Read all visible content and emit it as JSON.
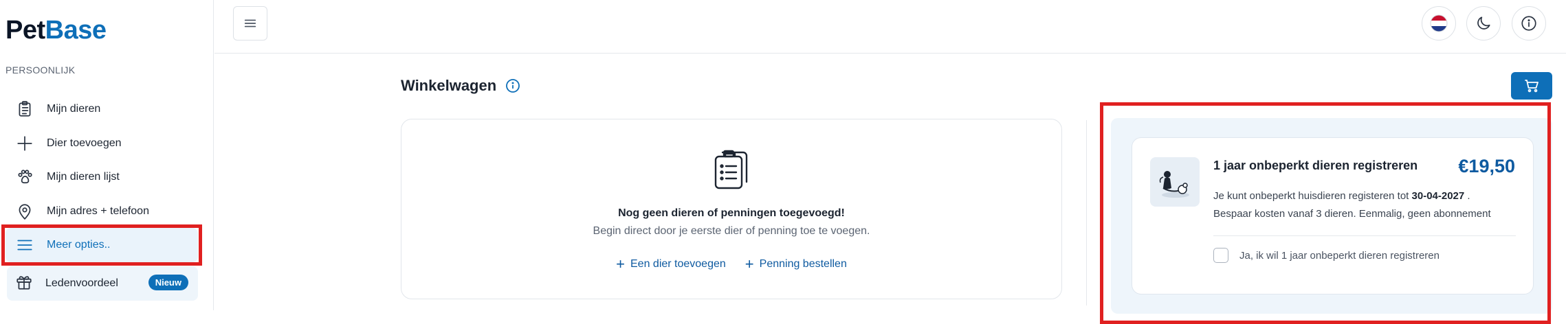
{
  "brand": {
    "logo_part1": "Pet",
    "logo_part2": "Base"
  },
  "sidebar": {
    "section_label": "PERSOONLIJK",
    "items": [
      {
        "label": "Mijn dieren",
        "icon": "clipboard-list-icon"
      },
      {
        "label": "Dier toevoegen",
        "icon": "plus-icon"
      },
      {
        "label": "Mijn dieren lijst",
        "icon": "paw-icon"
      },
      {
        "label": "Mijn adres + telefoon",
        "icon": "location-pin-icon"
      },
      {
        "label": "Meer opties..",
        "icon": "menu-lines-icon",
        "active": true
      }
    ],
    "perk": {
      "label": "Ledenvoordeel",
      "badge": "Nieuw",
      "icon": "gift-icon"
    }
  },
  "header": {
    "menu_icon": "hamburger-icon",
    "language_icon": "netherlands-flag-icon",
    "theme_icon": "moon-icon",
    "info_icon": "info-icon"
  },
  "main": {
    "title": "Winkelwagen",
    "cart_icon": "cart-icon",
    "empty": {
      "title": "Nog geen dieren of penningen toegevoegd!",
      "subtitle": "Begin direct door je eerste dier of penning toe te voegen.",
      "action_add_animal": "Een dier toevoegen",
      "action_order_tag": "Penning bestellen"
    }
  },
  "offer": {
    "title": "1 jaar onbeperkt dieren registreren",
    "price": "€19,50",
    "desc_prefix": "Je kunt onbeperkt huisdieren registeren tot ",
    "desc_date": "30-04-2027",
    "desc_suffix": " .",
    "desc_line2": "Bespaar kosten vanaf 3 dieren. Eenmalig, geen abonnement",
    "checkbox_label": "Ja, ik wil 1 jaar onbeperkt dieren registreren"
  },
  "colors": {
    "accent": "#0e6fb8",
    "highlight": "#e02020",
    "panel_bg": "#eef5fb"
  }
}
